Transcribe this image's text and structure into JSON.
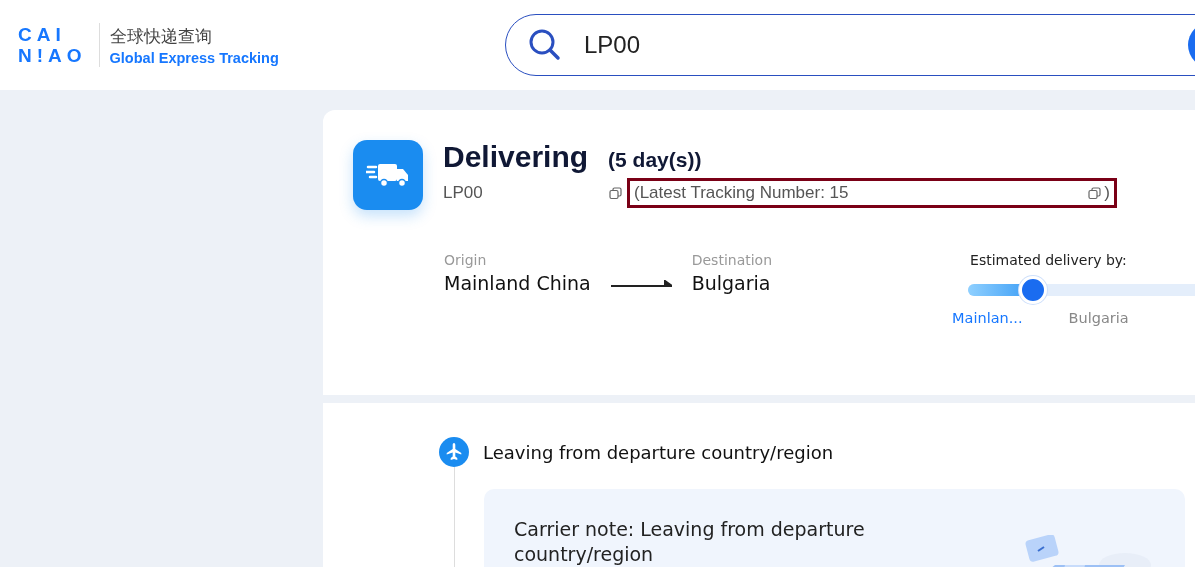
{
  "logo": {
    "lines": [
      "CAI",
      "N!AO"
    ],
    "title_cn": "全球快递查询",
    "title_en": "Global Express Tracking"
  },
  "search": {
    "value": "LP00"
  },
  "status": {
    "title": "Delivering",
    "duration": "(5 day(s))",
    "tracking_number": "LP00",
    "latest_tracking": "(Latest Tracking Number: 15",
    "latest_tracking_end": ")",
    "highlighted": true
  },
  "route": {
    "origin_label": "Origin",
    "origin": "Mainland China",
    "destination_label": "Destination",
    "destination": "Bulgaria"
  },
  "estimate": {
    "label": "Estimated delivery by:",
    "level": 0.25,
    "from": "Mainlan...",
    "to": "Bulgaria"
  },
  "events": [
    {
      "title": "Leaving from departure country/region",
      "note": "Carrier note: Leaving from departure country/region"
    }
  ]
}
